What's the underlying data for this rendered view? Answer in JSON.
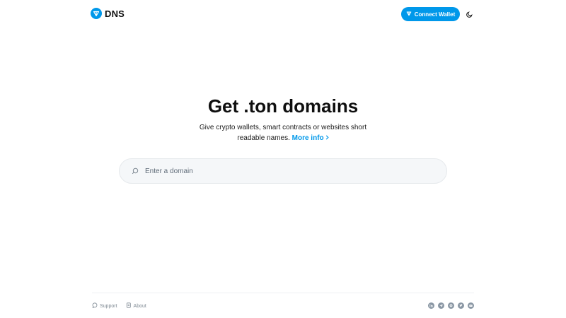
{
  "header": {
    "logo_text": "DNS",
    "connect_label": "Connect Wallet"
  },
  "hero": {
    "title": "Get .ton domains",
    "subtitle": "Give crypto wallets, smart contracts or websites short readable names.",
    "more_info": "More info"
  },
  "search": {
    "placeholder": "Enter a domain"
  },
  "footer": {
    "support": "Support",
    "about": "About",
    "socials": [
      "linkedin-icon",
      "telegram-icon",
      "github-icon",
      "twitter-icon",
      "email-icon"
    ]
  },
  "colors": {
    "accent": "#0098ea",
    "text": "#0f0f0f",
    "muted": "#7c8791",
    "search_bg": "#f5f7f9"
  }
}
